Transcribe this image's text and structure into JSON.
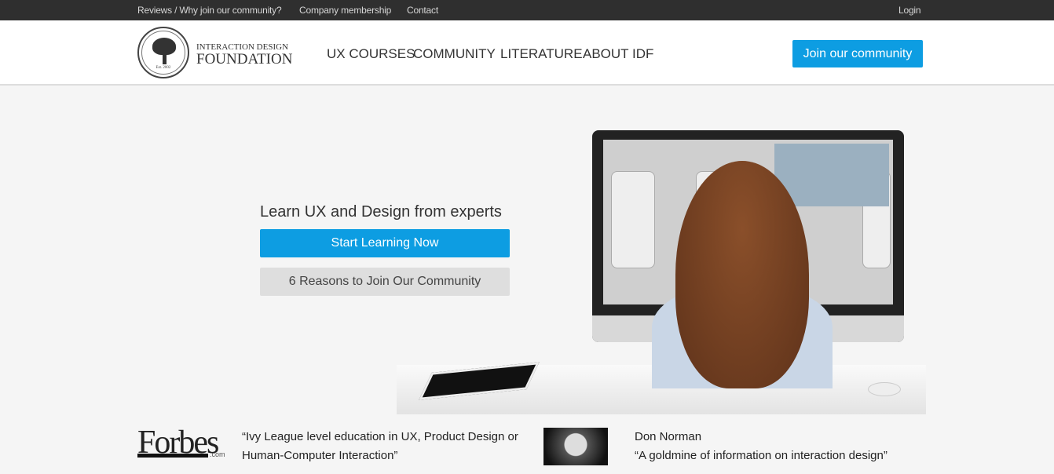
{
  "topbar": {
    "links": [
      "Reviews / Why join our community?",
      "Company membership",
      "Contact"
    ],
    "login": "Login"
  },
  "header": {
    "brand_line1": "INTERACTION DESIGN",
    "brand_line2": "FOUNDATION",
    "logo_est": "Est. 2002",
    "nav": [
      "UX COURSES",
      "COMMUNITY",
      "LITERATURE",
      "ABOUT IDF"
    ],
    "join": "Join our community"
  },
  "hero": {
    "title": "Learn UX and Design from experts",
    "start": "Start Learning Now",
    "reasons": "6 Reasons to Join Our Community"
  },
  "press": {
    "forbes_logo": "Forbes",
    "forbes_com": ".com",
    "forbes_quote_1": "“Ivy League level education in UX, Product Design or",
    "forbes_quote_2": "Human-Computer Interaction”",
    "person": "Don Norman",
    "person_quote": "“A goldmine of information on interaction design”"
  },
  "colors": {
    "accent": "#0d9de2",
    "topbar": "#2f2f2f"
  }
}
